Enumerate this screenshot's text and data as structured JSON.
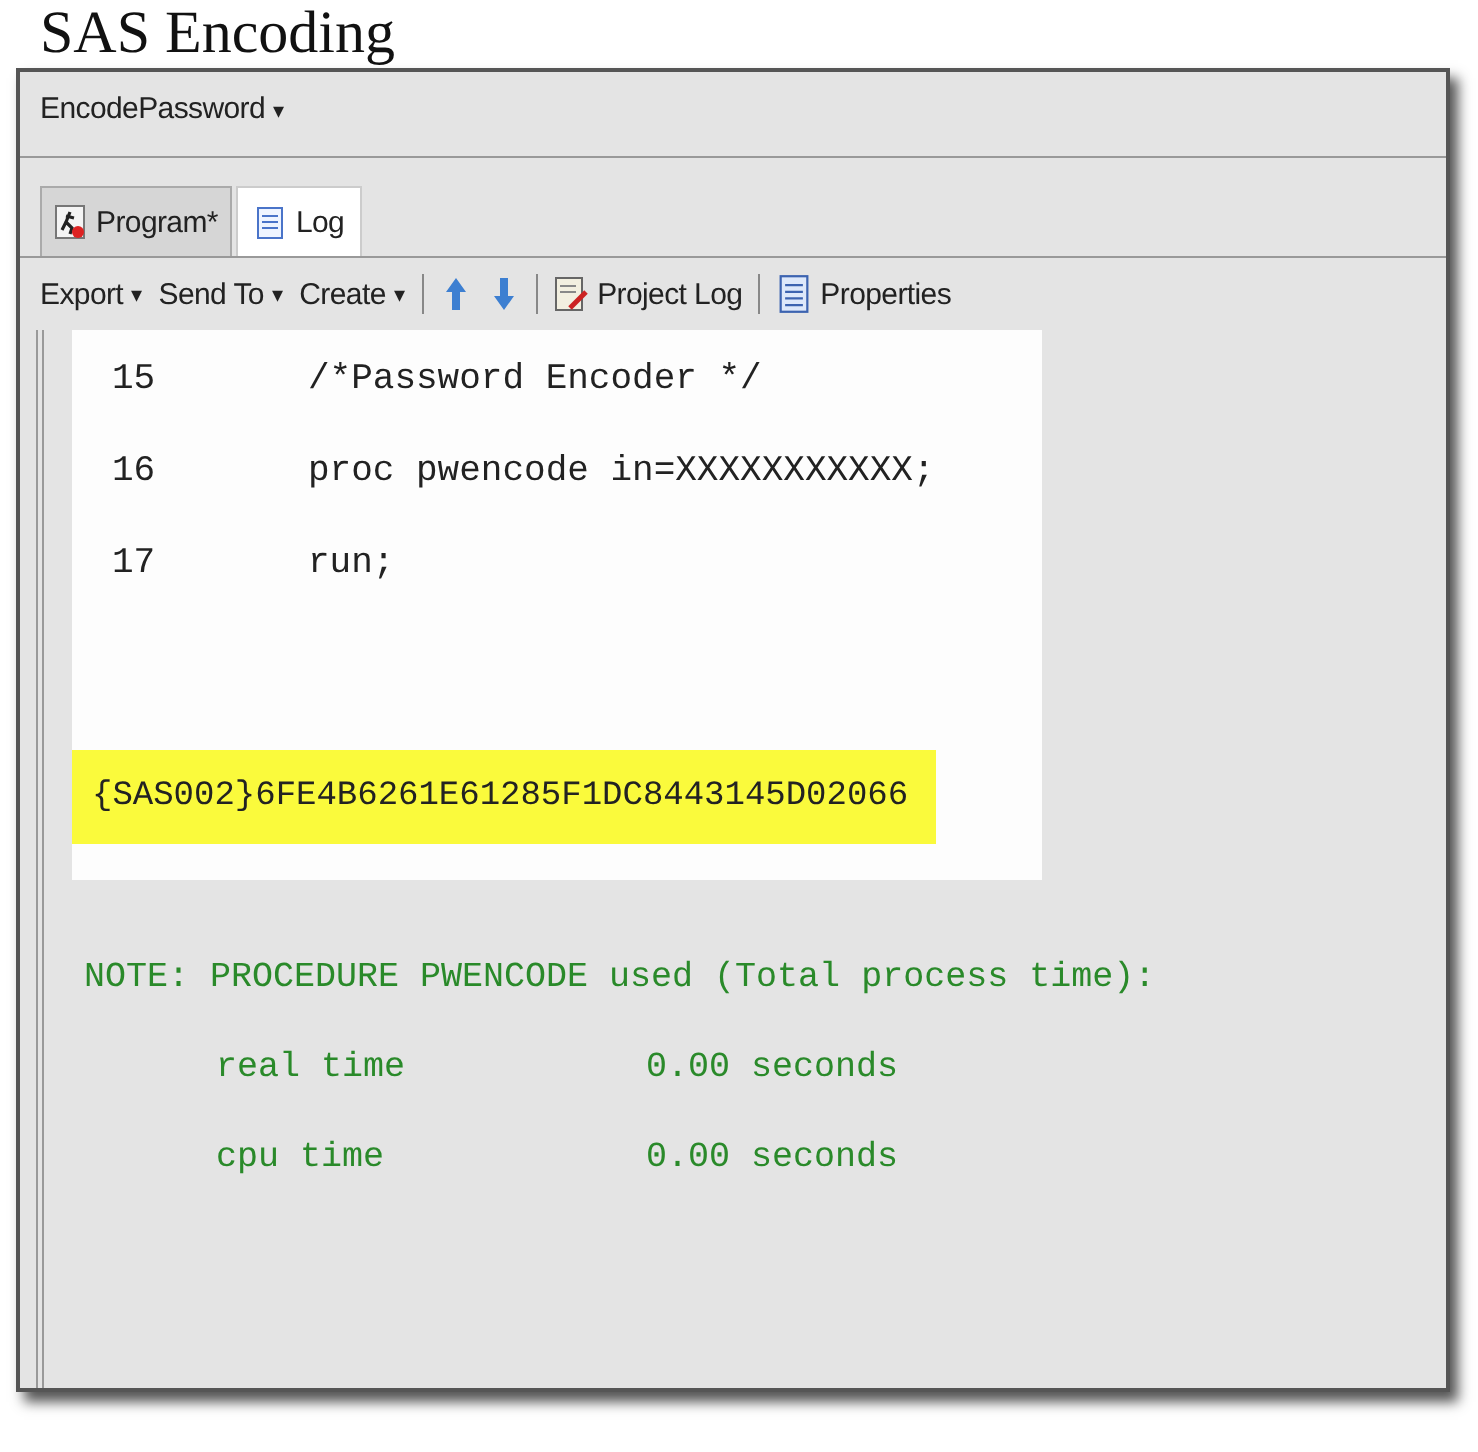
{
  "document_title": "SAS Encoding",
  "project": {
    "label": "EncodePassword",
    "caret": "▾"
  },
  "tabs": [
    {
      "label": "Program*",
      "selected": false
    },
    {
      "label": "Log",
      "selected": true
    }
  ],
  "toolbar": [
    {
      "kind": "menu",
      "label": "Export",
      "caret": "▾"
    },
    {
      "kind": "menu",
      "label": "Send To",
      "caret": "▾"
    },
    {
      "kind": "menu",
      "label": "Create",
      "caret": "▾"
    },
    {
      "kind": "separator"
    },
    {
      "kind": "up"
    },
    {
      "kind": "down"
    },
    {
      "kind": "separator"
    },
    {
      "kind": "log",
      "label": "Project Log"
    },
    {
      "kind": "separator"
    },
    {
      "kind": "properties",
      "label": "Properties"
    }
  ],
  "code_lines": [
    {
      "number": "15",
      "code": "/*Password Encoder */"
    },
    {
      "number": "16",
      "code": "proc pwencode in=XXXXXXXXXXX;"
    },
    {
      "number": "17",
      "code": "run;"
    }
  ],
  "encoded_output": {
    "text": "{SAS002}6FE4B6261E61285F1DC8443145D02066",
    "highlighted": true
  },
  "notes": [
    {
      "kind": "heading",
      "label": "NOTE: PROCEDURE PWENCODE used (Total process time):"
    },
    {
      "kind": "timing",
      "label": "real time",
      "value": "0.00 seconds"
    },
    {
      "kind": "timing",
      "label": "cpu time",
      "value": "0.00 seconds"
    }
  ]
}
